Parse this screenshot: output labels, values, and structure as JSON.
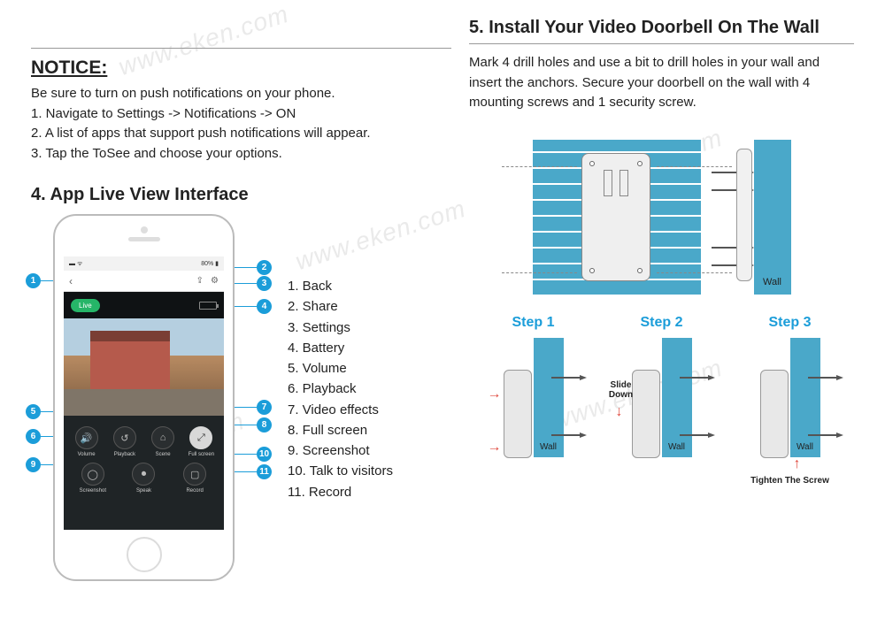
{
  "watermark": "www.eken.com",
  "left": {
    "notice_title": "NOTICE:",
    "notice_intro": "Be sure to turn on push notifications on your phone.",
    "notice_lines": [
      "1. Navigate to Settings -> Notifications -> ON",
      "2. A list of apps that support push notifications will appear.",
      "3. Tap the ToSee and choose your options."
    ],
    "section4_title": "4. App Live View Interface",
    "phone": {
      "time": "80%",
      "live_label": "Live",
      "controls_row1": [
        {
          "name": "volume",
          "label": "Volume",
          "glyph": "🔊"
        },
        {
          "name": "playback",
          "label": "Playback",
          "glyph": "↺"
        },
        {
          "name": "scene",
          "label": "Scene",
          "glyph": "⌂"
        },
        {
          "name": "fullscreen",
          "label": "Full screen",
          "glyph": "⤢",
          "full": true
        }
      ],
      "controls_row2": [
        {
          "name": "screenshot",
          "label": "Screenshot",
          "glyph": "◯"
        },
        {
          "name": "speak",
          "label": "Speak",
          "glyph": "⏺"
        },
        {
          "name": "record",
          "label": "Record",
          "glyph": "▢"
        }
      ]
    },
    "callouts": [
      "1",
      "2",
      "3",
      "4",
      "5",
      "6",
      "7",
      "8",
      "9",
      "10",
      "11"
    ],
    "legend": [
      "1. Back",
      "2. Share",
      "3. Settings",
      "4. Battery",
      "5. Volume",
      "6. Playback",
      "7. Video effects",
      "8. Full screen",
      "9. Screenshot",
      "10. Talk to visitors",
      "11. Record"
    ]
  },
  "right": {
    "section5_title": "5. Install Your Video Doorbell On The Wall",
    "section5_body": "Mark 4 drill holes and use a bit to drill holes in your wall and insert the anchors. Secure your doorbell on the wall with 4 mounting screws and 1 security screw.",
    "wall_label": "Wall",
    "steps": [
      {
        "title": "Step 1"
      },
      {
        "title": "Step 2",
        "hint": "Slide Down"
      },
      {
        "title": "Step 3",
        "tighten": "Tighten The Screw"
      }
    ]
  }
}
